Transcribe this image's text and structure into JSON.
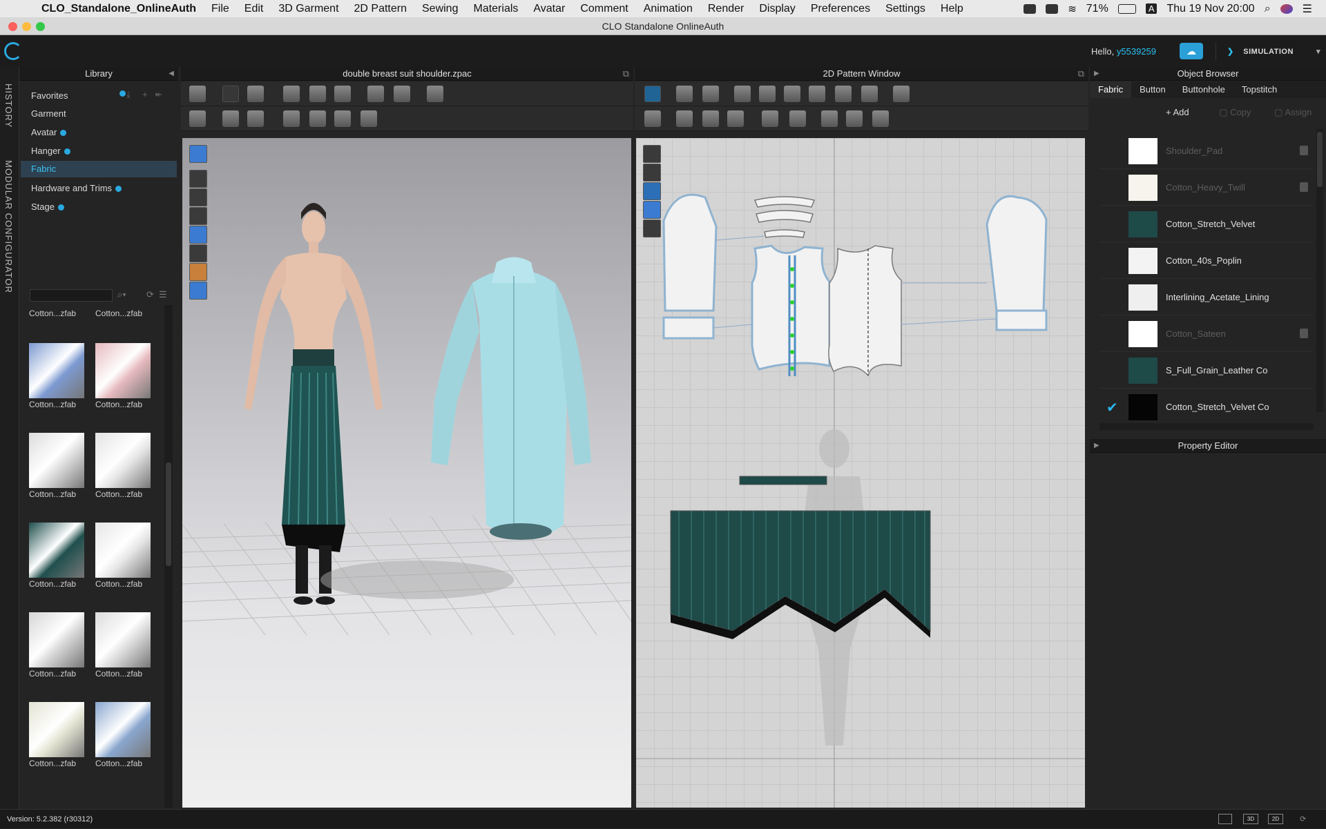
{
  "menubar": {
    "app_name": "CLO_Standalone_OnlineAuth",
    "items": [
      "File",
      "Edit",
      "3D Garment",
      "2D Pattern",
      "Sewing",
      "Materials",
      "Avatar",
      "Comment",
      "Animation",
      "Render",
      "Display",
      "Preferences",
      "Settings",
      "Help"
    ],
    "battery": "71%",
    "input_source": "A",
    "datetime": "Thu 19 Nov  20:00"
  },
  "window": {
    "title": "CLO Standalone OnlineAuth"
  },
  "header": {
    "greeting": "Hello,",
    "username": "y5539259",
    "mode_label": "SIMULATION"
  },
  "side_tabs": {
    "history": "HISTORY",
    "modular": "MODULAR CONFIGURATOR"
  },
  "library": {
    "title": "Library",
    "items": [
      {
        "label": "Favorites",
        "badge": true
      },
      {
        "label": "Garment",
        "badge": false
      },
      {
        "label": "Avatar",
        "badge": true
      },
      {
        "label": "Hanger",
        "badge": true
      },
      {
        "label": "Fabric",
        "badge": false
      },
      {
        "label": "Hardware and Trims",
        "badge": true
      },
      {
        "label": "Stage",
        "badge": true
      }
    ],
    "thumbnails": [
      {
        "label": "Cotton...zfab",
        "color": "#7d9ad1"
      },
      {
        "label": "Cotton...zfab",
        "color": "#e6b9bd"
      },
      {
        "label": "Cotton...zfab",
        "color": "#dcdcdc"
      },
      {
        "label": "Cotton...zfab",
        "color": "#e3e3e3"
      },
      {
        "label": "Cotton...zfab",
        "color": "#1f4f4d"
      },
      {
        "label": "Cotton...zfab",
        "color": "#e6e6e6"
      },
      {
        "label": "Cotton...zfab",
        "color": "#d6d6d6"
      },
      {
        "label": "Cotton...zfab",
        "color": "#dcdcdc"
      },
      {
        "label": "Cotton...zfab",
        "color": "#e3e3d2"
      },
      {
        "label": "Cotton...zfab",
        "color": "#8aa7cf"
      }
    ],
    "top_labels": [
      "Cotton...zfab",
      "Cotton...zfab"
    ]
  },
  "window3d": {
    "title": "double breast suit shoulder.zpac"
  },
  "window2d": {
    "title": "2D Pattern Window"
  },
  "object_browser": {
    "title": "Object Browser",
    "tabs": [
      "Fabric",
      "Button",
      "Buttonhole",
      "Topstitch"
    ],
    "actions": {
      "add": "Add",
      "copy": "Copy",
      "assign": "Assign"
    },
    "fabrics": [
      {
        "name": "Shoulder_Pad",
        "color": "#ffffff",
        "dim": true,
        "checked": false
      },
      {
        "name": "Cotton_Heavy_Twill",
        "color": "#f6f4ec",
        "dim": true,
        "checked": false
      },
      {
        "name": "Cotton_Stretch_Velvet",
        "color": "#1e4a48",
        "dim": false,
        "checked": false
      },
      {
        "name": "Cotton_40s_Poplin",
        "color": "#f3f3f3",
        "dim": false,
        "checked": false
      },
      {
        "name": "Interlining_Acetate_Lining",
        "color": "#efefef",
        "dim": false,
        "checked": false
      },
      {
        "name": "Cotton_Sateen",
        "color": "#ffffff",
        "dim": true,
        "checked": false
      },
      {
        "name": "S_Full_Grain_Leather Co",
        "color": "#1e4a48",
        "dim": false,
        "checked": false
      },
      {
        "name": "Cotton_Stretch_Velvet Co",
        "color": "#050505",
        "dim": false,
        "checked": true
      }
    ]
  },
  "property_editor": {
    "title": "Property Editor"
  },
  "status": {
    "version": "Version: 5.2.382 (r30312)"
  },
  "colors": {
    "accent": "#29a9e0",
    "velvet": "#1e4a48",
    "shirt": "#a8dde6"
  }
}
